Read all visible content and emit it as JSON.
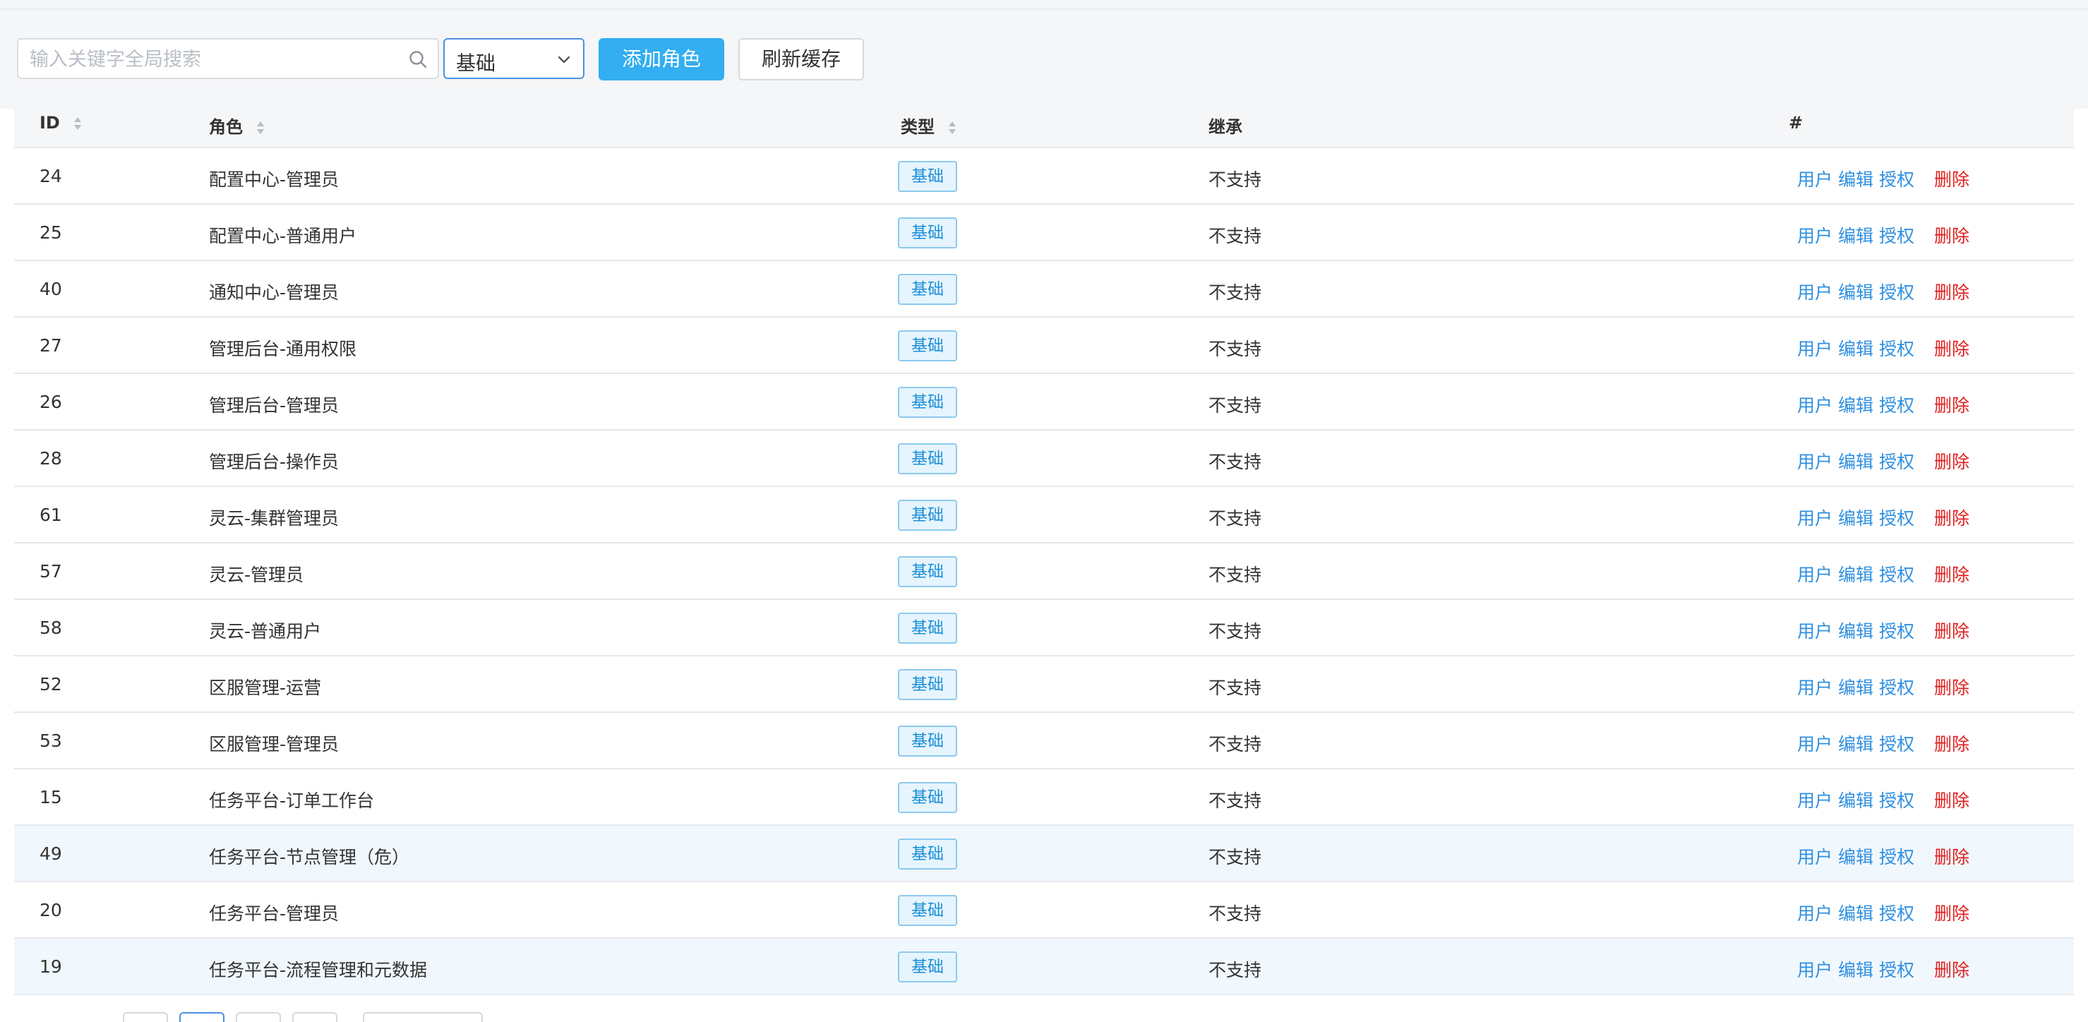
{
  "search": {
    "placeholder": "输入关键字全局搜索"
  },
  "type_filter": {
    "value": "基础"
  },
  "toolbar": {
    "add_label": "添加角色",
    "refresh_label": "刷新缓存"
  },
  "table": {
    "columns": {
      "id": "ID",
      "role": "角色",
      "type": "类型",
      "inherit": "继承",
      "actions": "#"
    },
    "action_labels": {
      "users": "用户",
      "edit": "编辑",
      "grant": "授权",
      "delete": "删除"
    },
    "rows": [
      {
        "id": "24",
        "role": "配置中心-管理员",
        "type": "基础",
        "inherit": "不支持"
      },
      {
        "id": "25",
        "role": "配置中心-普通用户",
        "type": "基础",
        "inherit": "不支持"
      },
      {
        "id": "40",
        "role": "通知中心-管理员",
        "type": "基础",
        "inherit": "不支持"
      },
      {
        "id": "27",
        "role": "管理后台-通用权限",
        "type": "基础",
        "inherit": "不支持"
      },
      {
        "id": "26",
        "role": "管理后台-管理员",
        "type": "基础",
        "inherit": "不支持"
      },
      {
        "id": "28",
        "role": "管理后台-操作员",
        "type": "基础",
        "inherit": "不支持"
      },
      {
        "id": "61",
        "role": "灵云-集群管理员",
        "type": "基础",
        "inherit": "不支持"
      },
      {
        "id": "57",
        "role": "灵云-管理员",
        "type": "基础",
        "inherit": "不支持"
      },
      {
        "id": "58",
        "role": "灵云-普通用户",
        "type": "基础",
        "inherit": "不支持"
      },
      {
        "id": "52",
        "role": "区服管理-运营",
        "type": "基础",
        "inherit": "不支持"
      },
      {
        "id": "53",
        "role": "区服管理-管理员",
        "type": "基础",
        "inherit": "不支持"
      },
      {
        "id": "15",
        "role": "任务平台-订单工作台",
        "type": "基础",
        "inherit": "不支持"
      },
      {
        "id": "49",
        "role": "任务平台-节点管理（危）",
        "type": "基础",
        "inherit": "不支持"
      },
      {
        "id": "20",
        "role": "任务平台-管理员",
        "type": "基础",
        "inherit": "不支持"
      },
      {
        "id": "19",
        "role": "任务平台-流程管理和元数据",
        "type": "基础",
        "inherit": "不支持"
      }
    ]
  },
  "colors": {
    "primary": "#33aef0",
    "link": "#2f8fe0",
    "danger": "#e0201f",
    "tag_bg": "#e6f4fd",
    "tag_border": "#8cc9ee",
    "row_highlight": "#f1f8fd"
  },
  "icons": {
    "search": "search-icon",
    "dropdown": "chevron-down-icon",
    "sort": "sort-icon"
  }
}
